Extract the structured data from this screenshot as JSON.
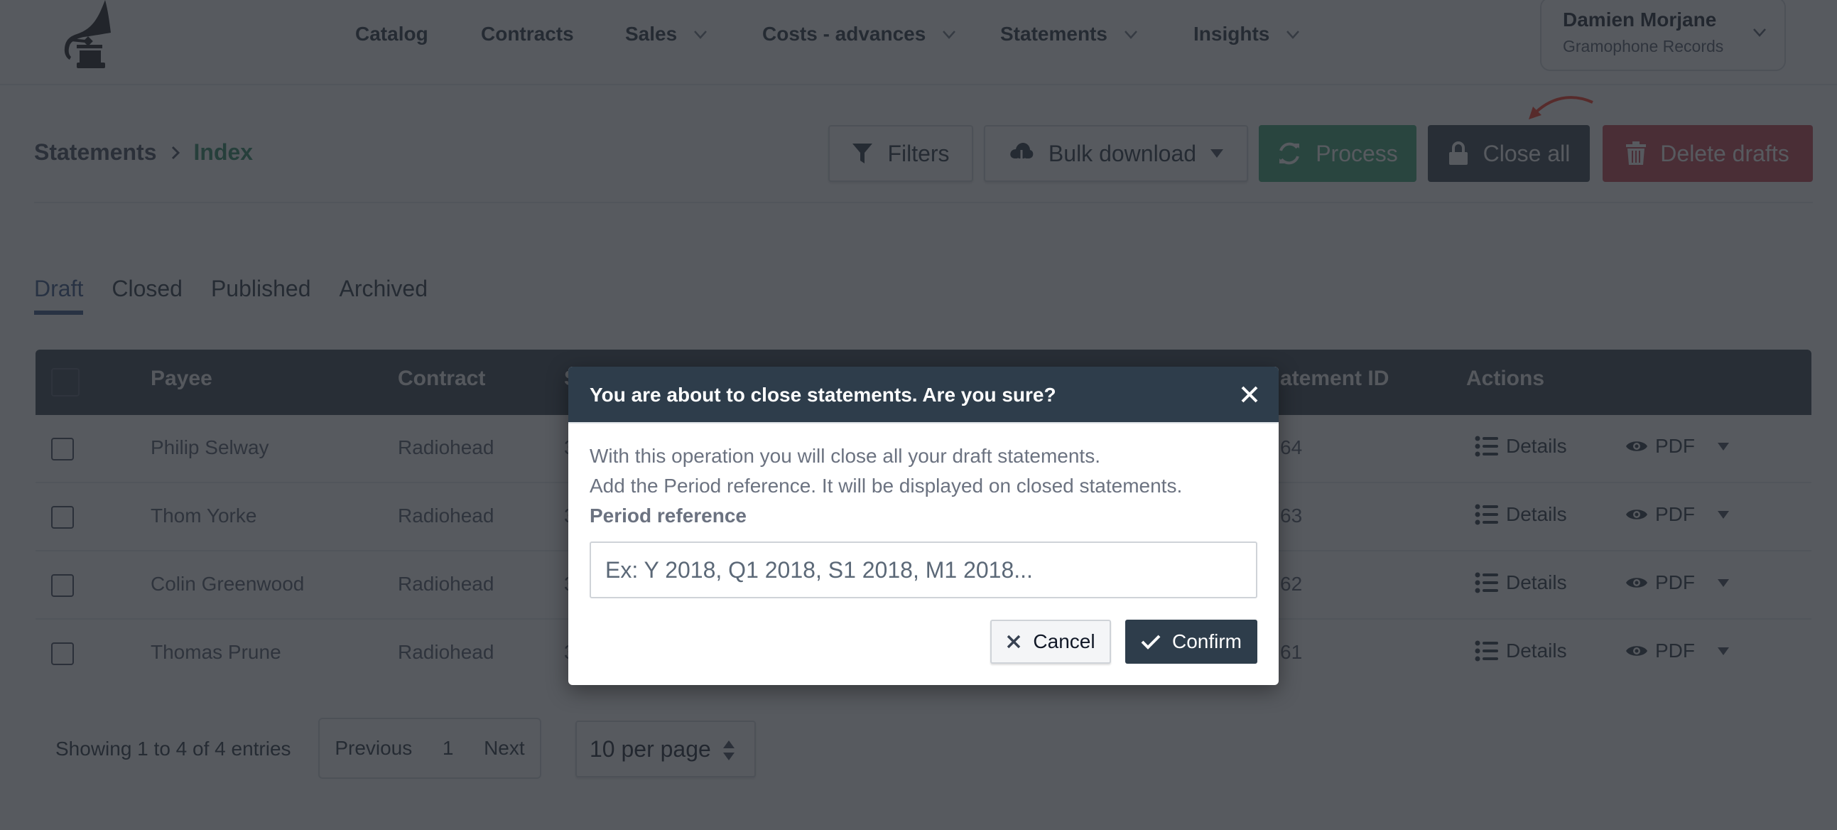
{
  "nav": {
    "logo": "gramophone-logo",
    "items": [
      {
        "label": "Catalog",
        "has_dropdown": false
      },
      {
        "label": "Contracts",
        "has_dropdown": false
      },
      {
        "label": "Sales",
        "has_dropdown": true
      },
      {
        "label": "Costs - advances",
        "has_dropdown": true
      },
      {
        "label": "Statements",
        "has_dropdown": true
      },
      {
        "label": "Insights",
        "has_dropdown": true
      }
    ],
    "user": {
      "name": "Damien Morjane",
      "organization": "Gramophone Records"
    }
  },
  "breadcrumb": {
    "root": "Statements",
    "current": "Index"
  },
  "toolbar": {
    "filters_label": "Filters",
    "bulk_download_label": "Bulk download",
    "process_label": "Process",
    "close_all_label": "Close all",
    "delete_drafts_label": "Delete drafts"
  },
  "tabs": [
    {
      "label": "Draft",
      "active": true
    },
    {
      "label": "Closed",
      "active": false
    },
    {
      "label": "Published",
      "active": false
    },
    {
      "label": "Archived",
      "active": false
    }
  ],
  "table": {
    "columns": {
      "payee": "Payee",
      "contract": "Contract",
      "col3_partial": "S",
      "statement_id_partial": "atement ID",
      "actions": "Actions"
    },
    "rows": [
      {
        "payee": "Philip Selway",
        "contract": "Radiohead",
        "col3_partial": "3",
        "id_partial": "64"
      },
      {
        "payee": "Thom Yorke",
        "contract": "Radiohead",
        "col3_partial": "3",
        "id_partial": "63"
      },
      {
        "payee": "Colin Greenwood",
        "contract": "Radiohead",
        "col3_partial": "3",
        "id_partial": "62"
      },
      {
        "payee": "Thomas Prune",
        "contract": "Radiohead",
        "col3_partial": "3",
        "id_partial": "61"
      }
    ],
    "action_details_label": "Details",
    "action_pdf_label": "PDF"
  },
  "footer": {
    "showing": "Showing 1 to 4 of 4 entries",
    "previous": "Previous",
    "page": "1",
    "next": "Next",
    "per_page": "10 per page"
  },
  "modal": {
    "title": "You are about to close statements. Are you sure?",
    "line1": "With this operation you will close all your draft statements.",
    "line2": "Add the Period reference. It will be displayed on closed statements.",
    "field_label": "Period reference",
    "field_value": "",
    "field_placeholder": "Ex: Y 2018, Q1 2018, S1 2018, M1 2018...",
    "cancel_label": "Cancel",
    "confirm_label": "Confirm"
  },
  "colors": {
    "brand_green": "#2d9f6c",
    "dark": "#2b3947",
    "danger": "#c23a46",
    "active_tab": "#2b4b80",
    "annotation_red": "#e02a1a"
  }
}
